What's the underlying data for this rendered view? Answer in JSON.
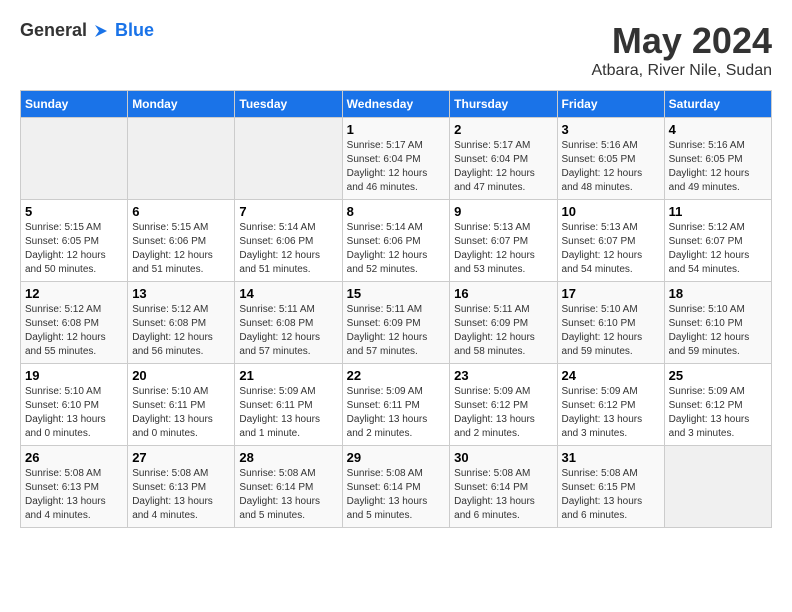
{
  "header": {
    "logo_general": "General",
    "logo_blue": "Blue",
    "title": "May 2024",
    "subtitle": "Atbara, River Nile, Sudan"
  },
  "days_of_week": [
    "Sunday",
    "Monday",
    "Tuesday",
    "Wednesday",
    "Thursday",
    "Friday",
    "Saturday"
  ],
  "weeks": [
    [
      {
        "day": "",
        "info": ""
      },
      {
        "day": "",
        "info": ""
      },
      {
        "day": "",
        "info": ""
      },
      {
        "day": "1",
        "info": "Sunrise: 5:17 AM\nSunset: 6:04 PM\nDaylight: 12 hours and 46 minutes."
      },
      {
        "day": "2",
        "info": "Sunrise: 5:17 AM\nSunset: 6:04 PM\nDaylight: 12 hours and 47 minutes."
      },
      {
        "day": "3",
        "info": "Sunrise: 5:16 AM\nSunset: 6:05 PM\nDaylight: 12 hours and 48 minutes."
      },
      {
        "day": "4",
        "info": "Sunrise: 5:16 AM\nSunset: 6:05 PM\nDaylight: 12 hours and 49 minutes."
      }
    ],
    [
      {
        "day": "5",
        "info": "Sunrise: 5:15 AM\nSunset: 6:05 PM\nDaylight: 12 hours and 50 minutes."
      },
      {
        "day": "6",
        "info": "Sunrise: 5:15 AM\nSunset: 6:06 PM\nDaylight: 12 hours and 51 minutes."
      },
      {
        "day": "7",
        "info": "Sunrise: 5:14 AM\nSunset: 6:06 PM\nDaylight: 12 hours and 51 minutes."
      },
      {
        "day": "8",
        "info": "Sunrise: 5:14 AM\nSunset: 6:06 PM\nDaylight: 12 hours and 52 minutes."
      },
      {
        "day": "9",
        "info": "Sunrise: 5:13 AM\nSunset: 6:07 PM\nDaylight: 12 hours and 53 minutes."
      },
      {
        "day": "10",
        "info": "Sunrise: 5:13 AM\nSunset: 6:07 PM\nDaylight: 12 hours and 54 minutes."
      },
      {
        "day": "11",
        "info": "Sunrise: 5:12 AM\nSunset: 6:07 PM\nDaylight: 12 hours and 54 minutes."
      }
    ],
    [
      {
        "day": "12",
        "info": "Sunrise: 5:12 AM\nSunset: 6:08 PM\nDaylight: 12 hours and 55 minutes."
      },
      {
        "day": "13",
        "info": "Sunrise: 5:12 AM\nSunset: 6:08 PM\nDaylight: 12 hours and 56 minutes."
      },
      {
        "day": "14",
        "info": "Sunrise: 5:11 AM\nSunset: 6:08 PM\nDaylight: 12 hours and 57 minutes."
      },
      {
        "day": "15",
        "info": "Sunrise: 5:11 AM\nSunset: 6:09 PM\nDaylight: 12 hours and 57 minutes."
      },
      {
        "day": "16",
        "info": "Sunrise: 5:11 AM\nSunset: 6:09 PM\nDaylight: 12 hours and 58 minutes."
      },
      {
        "day": "17",
        "info": "Sunrise: 5:10 AM\nSunset: 6:10 PM\nDaylight: 12 hours and 59 minutes."
      },
      {
        "day": "18",
        "info": "Sunrise: 5:10 AM\nSunset: 6:10 PM\nDaylight: 12 hours and 59 minutes."
      }
    ],
    [
      {
        "day": "19",
        "info": "Sunrise: 5:10 AM\nSunset: 6:10 PM\nDaylight: 13 hours and 0 minutes."
      },
      {
        "day": "20",
        "info": "Sunrise: 5:10 AM\nSunset: 6:11 PM\nDaylight: 13 hours and 0 minutes."
      },
      {
        "day": "21",
        "info": "Sunrise: 5:09 AM\nSunset: 6:11 PM\nDaylight: 13 hours and 1 minute."
      },
      {
        "day": "22",
        "info": "Sunrise: 5:09 AM\nSunset: 6:11 PM\nDaylight: 13 hours and 2 minutes."
      },
      {
        "day": "23",
        "info": "Sunrise: 5:09 AM\nSunset: 6:12 PM\nDaylight: 13 hours and 2 minutes."
      },
      {
        "day": "24",
        "info": "Sunrise: 5:09 AM\nSunset: 6:12 PM\nDaylight: 13 hours and 3 minutes."
      },
      {
        "day": "25",
        "info": "Sunrise: 5:09 AM\nSunset: 6:12 PM\nDaylight: 13 hours and 3 minutes."
      }
    ],
    [
      {
        "day": "26",
        "info": "Sunrise: 5:08 AM\nSunset: 6:13 PM\nDaylight: 13 hours and 4 minutes."
      },
      {
        "day": "27",
        "info": "Sunrise: 5:08 AM\nSunset: 6:13 PM\nDaylight: 13 hours and 4 minutes."
      },
      {
        "day": "28",
        "info": "Sunrise: 5:08 AM\nSunset: 6:14 PM\nDaylight: 13 hours and 5 minutes."
      },
      {
        "day": "29",
        "info": "Sunrise: 5:08 AM\nSunset: 6:14 PM\nDaylight: 13 hours and 5 minutes."
      },
      {
        "day": "30",
        "info": "Sunrise: 5:08 AM\nSunset: 6:14 PM\nDaylight: 13 hours and 6 minutes."
      },
      {
        "day": "31",
        "info": "Sunrise: 5:08 AM\nSunset: 6:15 PM\nDaylight: 13 hours and 6 minutes."
      },
      {
        "day": "",
        "info": ""
      }
    ]
  ]
}
